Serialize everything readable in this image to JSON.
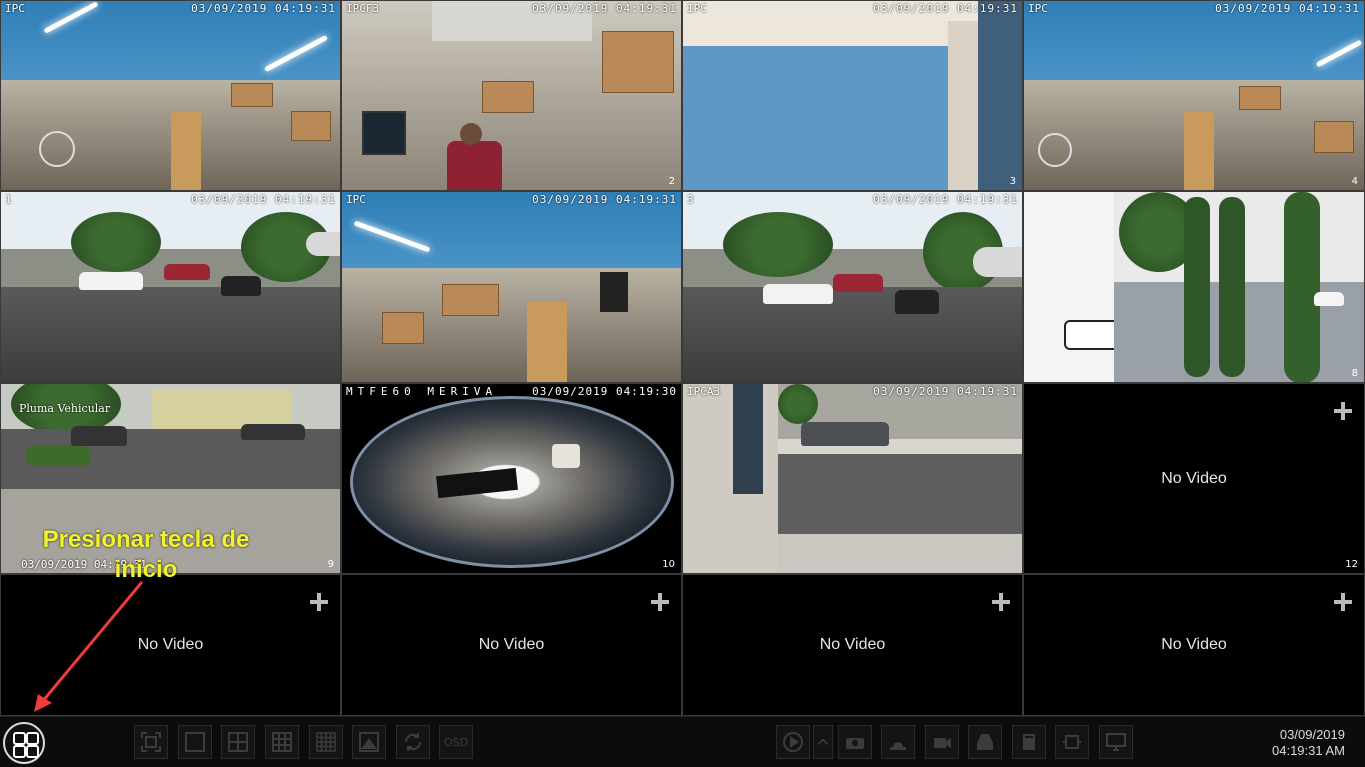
{
  "tiles": [
    {
      "cam": "IPC",
      "timestamp": "03/09/2019 04:19:31",
      "number": ""
    },
    {
      "cam": "IPCF3",
      "timestamp": "03/09/2019 04:19:31",
      "number": "2"
    },
    {
      "cam": "IPC",
      "timestamp": "03/09/2019 04:19:31",
      "number": "3"
    },
    {
      "cam": "IPC",
      "timestamp": "03/09/2019 04:19:31",
      "number": "4"
    },
    {
      "cam": "1",
      "timestamp": "03/09/2019 04:19:31",
      "number": ""
    },
    {
      "cam": "IPC",
      "timestamp": "03/09/2019 04:19:31",
      "number": ""
    },
    {
      "cam": "3",
      "timestamp": "03/09/2019 04:19:31",
      "number": ""
    },
    {
      "cam": "",
      "timestamp": "",
      "number": "8"
    },
    {
      "cam": "",
      "timestamp": "",
      "number": "9",
      "overlay": "Pluma Vehicular",
      "bottom_timestamp": "03/09/2019 04:19:31"
    },
    {
      "cam": "MTFE60 MERIVA",
      "timestamp": "03/09/2019 04:19:30",
      "number": "10"
    },
    {
      "cam": "IPCA3",
      "timestamp": "03/09/2019 04:19:31",
      "number": ""
    },
    {
      "no_video": "No Video",
      "number": "12"
    },
    {
      "no_video": "No Video",
      "number": ""
    },
    {
      "no_video": "No Video",
      "number": ""
    },
    {
      "no_video": "No Video",
      "number": ""
    },
    {
      "no_video": "No Video",
      "number": ""
    }
  ],
  "annotation": {
    "text": "Presionar tecla de inicio",
    "color": "#f3f32a",
    "arrow_color": "#ef3b3b"
  },
  "toolbar": {
    "start_icon": "start-menu-icon",
    "left_buttons": [
      "fullscreen-icon",
      "layout-1-icon",
      "layout-4-icon",
      "layout-9-icon",
      "layout-16-icon",
      "image-icon",
      "refresh-icon"
    ],
    "osd_label": "OSD",
    "right_buttons": [
      "playback-icon",
      "expand-up-icon",
      "camera-icon",
      "alarm-icon",
      "record-icon",
      "backup-icon",
      "disk-icon",
      "ptz-icon",
      "monitor-icon"
    ],
    "date": "03/09/2019",
    "time": "04:19:31 AM"
  }
}
